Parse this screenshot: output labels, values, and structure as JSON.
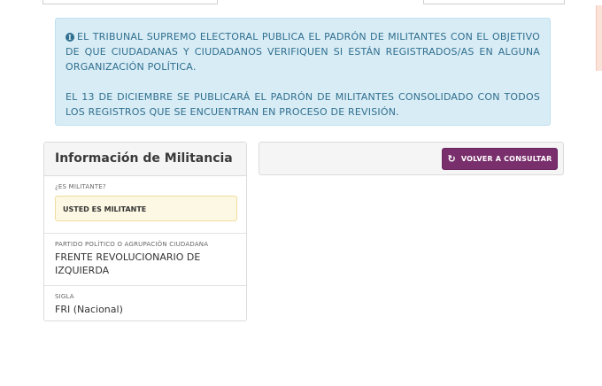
{
  "notice": {
    "paragraph1": "El Tribunal Supremo Electoral publica el padrón de militantes con el objetivo de que ciudadanas y ciudadanos verifiquen si están registrados/as en alguna organización política.",
    "paragraph2": "El 13 de diciembre se publicará el padrón de militantes consolidado con todos los registros que se encuentran en proceso de revisión.",
    "icon": "info-icon"
  },
  "militancy_card": {
    "title": "Información de Militancia",
    "is_militant_label": "¿Es militante?",
    "is_militant_value": "USTED ES MILITANTE",
    "party_label": "Partido político o agrupación ciudadana",
    "party_value": "FRENTE REVOLUCIONARIO DE IZQUIERDA",
    "acronym_label": "Sigla",
    "acronym_value": "FRI (Nacional)"
  },
  "actions": {
    "reconsult_label": "Volver a consultar",
    "reconsult_icon": "refresh-icon",
    "button_color": "#7a2f6d"
  }
}
